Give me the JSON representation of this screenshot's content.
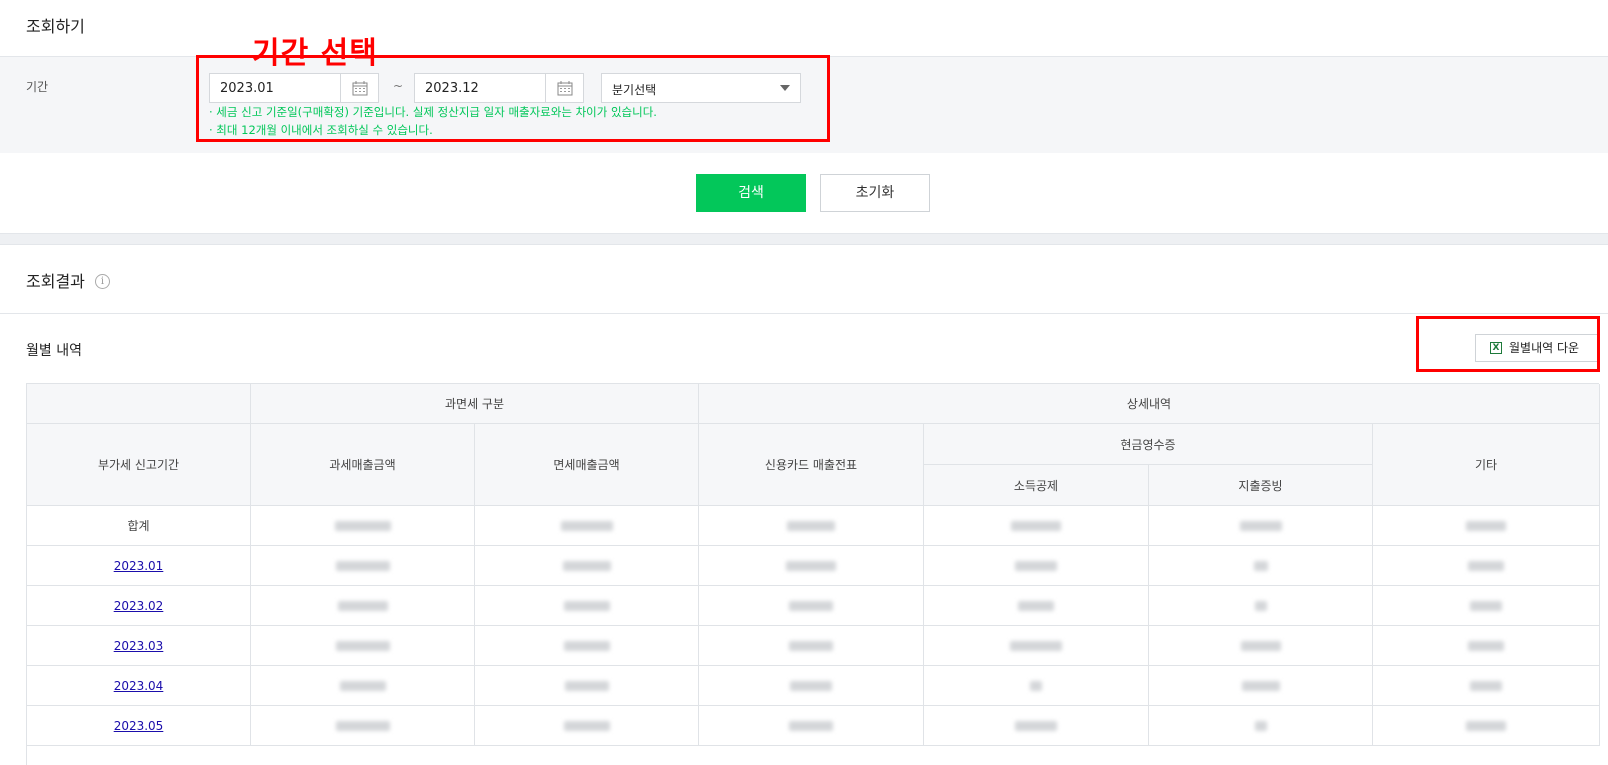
{
  "search": {
    "title": "조회하기",
    "period_label": "기간",
    "start_date": "2023.01",
    "end_date": "2023.12",
    "range_separator": "~",
    "quarter_select": "분기선택",
    "notes": [
      "· 세금 신고 기준일(구매확정) 기준입니다. 실제 정산지급 일자 매출자료와는 차이가 있습니다.",
      "· 최대 12개월 이내에서 조회하실 수 있습니다."
    ],
    "search_button": "검색",
    "reset_button": "초기화"
  },
  "annotation": {
    "period_label": "기간 선택",
    "color": "#ff0000"
  },
  "results": {
    "title": "조회결과",
    "info_icon": "i",
    "monthly_title": "월별 내역",
    "download_button": "월별내역 다운",
    "download_icon": "X"
  },
  "table": {
    "group_headers": {
      "tax_type": "과면세 구분",
      "details": "상세내역",
      "cash_receipt": "현금영수증"
    },
    "columns": {
      "period": "부가세 신고기간",
      "taxable_sales": "과세매출금액",
      "exempt_sales": "면세매출금액",
      "card_slips": "신용카드 매출전표",
      "income_deduction": "소득공제",
      "expense_proof": "지출증빙",
      "other": "기타"
    },
    "rows": [
      {
        "period": "합계",
        "link": false
      },
      {
        "period": "2023.01",
        "link": true
      },
      {
        "period": "2023.02",
        "link": true
      },
      {
        "period": "2023.03",
        "link": true
      },
      {
        "period": "2023.04",
        "link": true
      },
      {
        "period": "2023.05",
        "link": true
      }
    ]
  },
  "colors": {
    "accent_green": "#03c75a",
    "link_blue": "#1a0dab",
    "annotation_red": "#ff0000"
  }
}
